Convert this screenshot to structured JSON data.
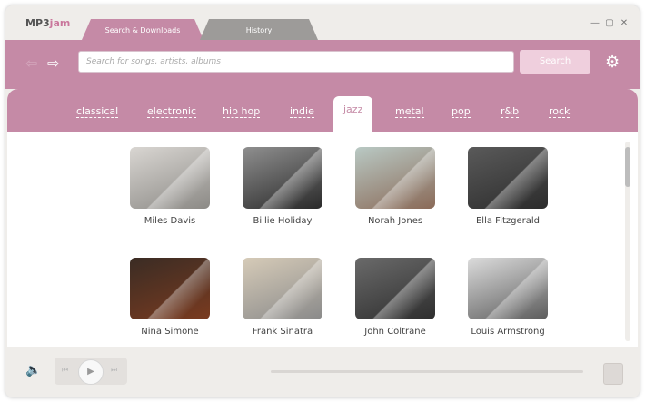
{
  "app": {
    "logo_prefix": "MP3",
    "logo_suffix": "jam"
  },
  "tabs": [
    {
      "label": "Search & Downloads"
    },
    {
      "label": "History"
    }
  ],
  "window_controls": {
    "minimize": "—",
    "restore": "▢",
    "close": "✕"
  },
  "search": {
    "placeholder": "Search for songs, artists, albums",
    "value": "",
    "button_label": "Search"
  },
  "genres": [
    "classical",
    "electronic",
    "hip hop",
    "indie",
    "jazz",
    "metal",
    "pop",
    "r&b",
    "rock"
  ],
  "active_genre": "jazz",
  "artists": [
    {
      "name": "Miles Davis",
      "colors": [
        "#d9d6d2",
        "#8c8a86"
      ]
    },
    {
      "name": "Billie Holiday",
      "colors": [
        "#8f8f8f",
        "#2a2a2a"
      ]
    },
    {
      "name": "Norah Jones",
      "colors": [
        "#b9c9c4",
        "#8a6a58"
      ]
    },
    {
      "name": "Ella Fitzgerald",
      "colors": [
        "#5a5a5a",
        "#2c2c2c"
      ]
    },
    {
      "name": "Nina Simone",
      "colors": [
        "#3a2c24",
        "#7a3b20"
      ]
    },
    {
      "name": "Frank Sinatra",
      "colors": [
        "#d6cbb8",
        "#8a8a8a"
      ]
    },
    {
      "name": "John Coltrane",
      "colors": [
        "#6a6a6a",
        "#2e2e2e"
      ]
    },
    {
      "name": "Louis Armstrong",
      "colors": [
        "#dcdcdc",
        "#5c5c5c"
      ]
    }
  ],
  "player": {
    "volume_icon": "speaker-icon",
    "prev_icon": "prev-icon",
    "play_icon": "play-icon",
    "next_icon": "next-icon"
  }
}
